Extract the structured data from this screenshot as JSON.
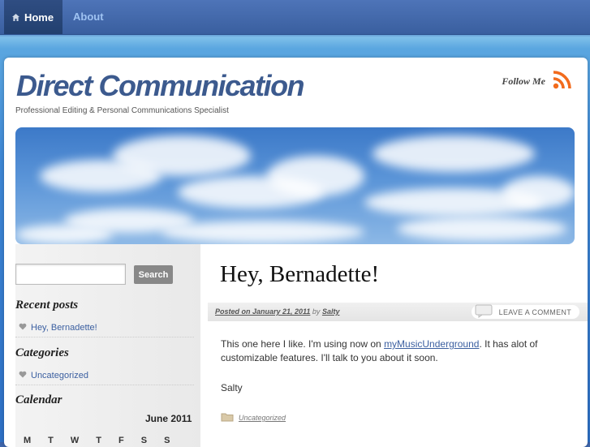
{
  "nav": {
    "home_label": "Home",
    "about_label": "About"
  },
  "header": {
    "site_title": "Direct Communication",
    "tagline": "Professional Editing & Personal Communications Specialist",
    "follow_label": "Follow Me"
  },
  "sidebar": {
    "search_button": "Search",
    "search_value": "",
    "recent_title": "Recent posts",
    "recent_items": [
      "Hey, Bernadette!"
    ],
    "categories_title": "Categories",
    "category_items": [
      "Uncategorized"
    ],
    "calendar_title": "Calendar",
    "calendar_month": "June 2011",
    "calendar_days": [
      "M",
      "T",
      "W",
      "T",
      "F",
      "S",
      "S"
    ]
  },
  "post": {
    "title": "Hey, Bernadette!",
    "posted_on": "Posted on January 21, 2011",
    "by": "by",
    "author": "Salty",
    "comment_label": "LEAVE A COMMENT",
    "body_pre": "This one here I like. I'm using now on ",
    "body_link": "myMusicUnderground",
    "body_post": ".  It has alot of customizable features.  I'll talk to you about it soon.",
    "signature": "Salty",
    "category": "Uncategorized"
  },
  "colors": {
    "nav_bg": "#3a5f9f",
    "title": "#3c5a8e",
    "link": "#3b5fa0",
    "rss": "#f26b1d"
  }
}
